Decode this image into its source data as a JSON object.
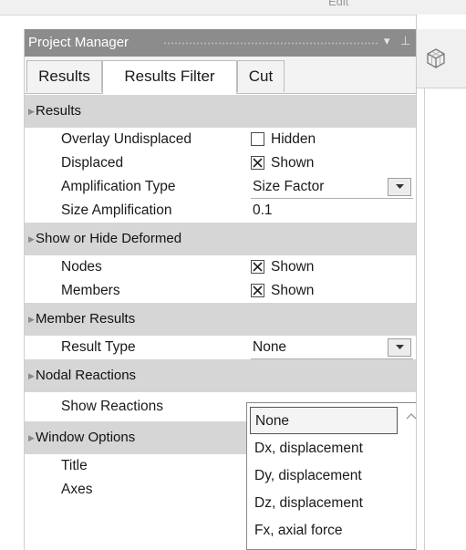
{
  "header": {
    "edit_label": "Edit"
  },
  "panel": {
    "title": "Project Manager",
    "pin_icon": "pin-icon",
    "menu_icon": "chevron-down-icon",
    "pin_glyph": "⊥",
    "menu_glyph": "▾"
  },
  "tabs": [
    {
      "label": "Results",
      "active": false
    },
    {
      "label": "Results Filter",
      "active": true
    },
    {
      "label": "Cut",
      "active": false
    }
  ],
  "sections": {
    "results": {
      "title": "Results",
      "rows": {
        "overlay_undisplaced": {
          "name": "Overlay Undisplaced",
          "checked": false,
          "value": "Hidden"
        },
        "displaced": {
          "name": "Displaced",
          "checked": true,
          "value": "Shown"
        },
        "amplification_type": {
          "name": "Amplification Type",
          "value": "Size Factor"
        },
        "size_amplification": {
          "name": "Size Amplification",
          "value": "0.1"
        }
      }
    },
    "deformed": {
      "title": "Show or Hide Deformed",
      "rows": {
        "nodes": {
          "name": "Nodes",
          "checked": true,
          "value": "Shown"
        },
        "members": {
          "name": "Members",
          "checked": true,
          "value": "Shown"
        }
      }
    },
    "member_results": {
      "title": "Member Results",
      "rows": {
        "result_type": {
          "name": "Result Type",
          "value": "None"
        }
      }
    },
    "nodal_reactions": {
      "title": "Nodal Reactions",
      "rows": {
        "show_reactions": {
          "name": "Show Reactions"
        }
      }
    },
    "window_options": {
      "title": "Window Options",
      "rows": {
        "title": {
          "name": "Title"
        },
        "axes": {
          "name": "Axes"
        }
      }
    }
  },
  "dropdown": {
    "options": [
      "None",
      "Dx, displacement",
      "Dy, displacement",
      "Dz, displacement",
      "Fx, axial force"
    ],
    "selected": "None",
    "scroll_icon": "chevron-up-icon"
  },
  "right_panel": {
    "icon": "cube-view-icon"
  },
  "colors": {
    "titlebar": "#8c8c8c",
    "section_header": "#d6d6d6",
    "tab_bg": "#f3f3f3"
  }
}
